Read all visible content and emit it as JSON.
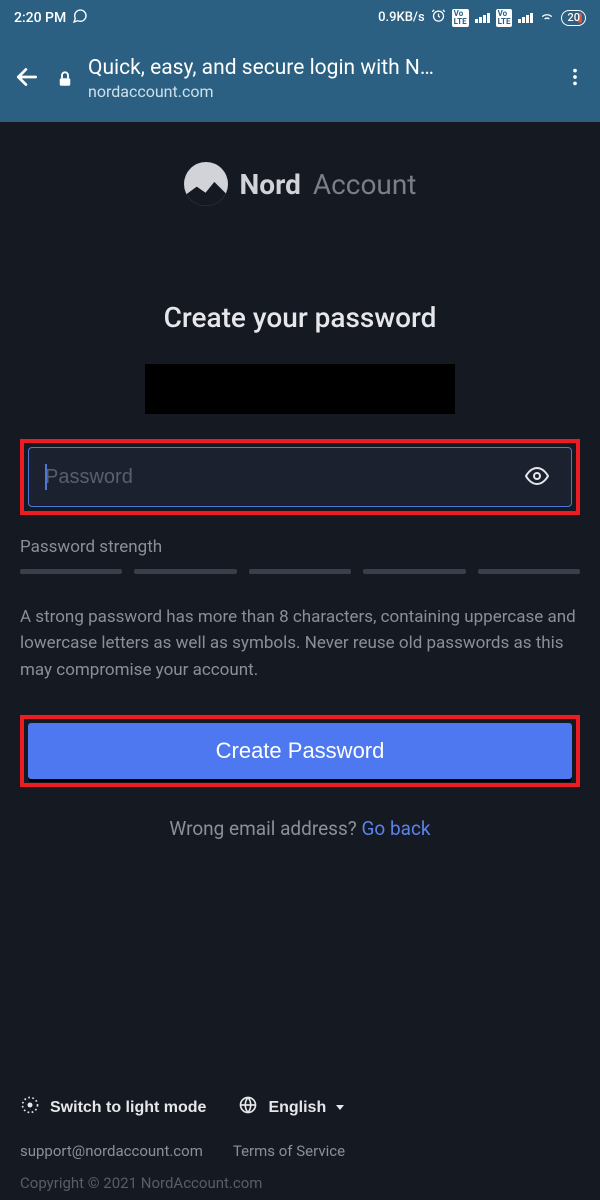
{
  "status": {
    "time": "2:20 PM",
    "net_speed": "0.9KB/s",
    "battery_pct": "20",
    "volte": "Vo LTE"
  },
  "browser": {
    "page_title": "Quick, easy, and secure login with N…",
    "url": "nordaccount.com"
  },
  "logo": {
    "brand": "Nord",
    "suffix": "Account"
  },
  "main": {
    "heading": "Create your password",
    "password_placeholder": "Password",
    "password_value": "",
    "strength_label": "Password strength",
    "hint": "A strong password has more than 8 characters, containing uppercase and lowercase letters as well as symbols. Never reuse old passwords as this may compromise your account.",
    "create_label": "Create Password",
    "wrong_email_text": "Wrong email address? ",
    "go_back_label": "Go back"
  },
  "footer": {
    "theme_label": "Switch to light mode",
    "language_label": "English",
    "support_email": "support@nordaccount.com",
    "tos_label": "Terms of Service",
    "copyright": "Copyright © 2021 NordAccount.com"
  }
}
